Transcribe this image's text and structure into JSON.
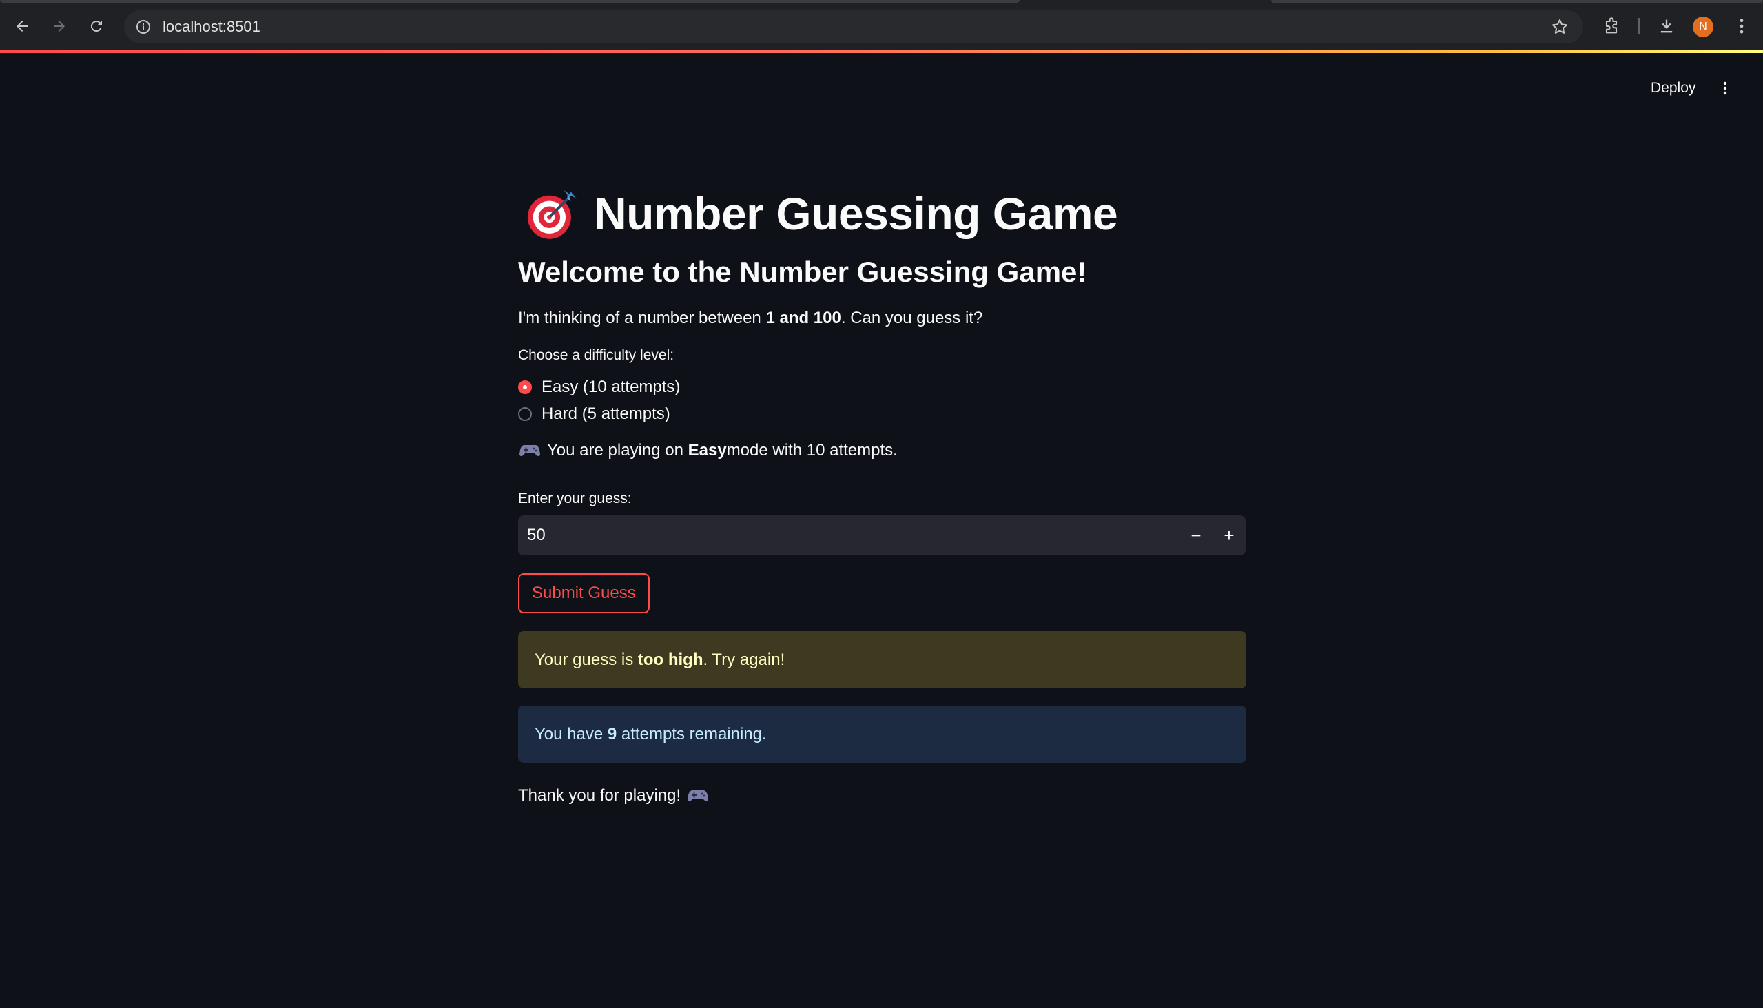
{
  "browser": {
    "url": "localhost:8501",
    "avatar_initial": "N"
  },
  "app_header": {
    "deploy_label": "Deploy"
  },
  "main": {
    "title": "Number Guessing Game",
    "subheading": "Welcome to the Number Guessing Game!",
    "intro": {
      "prefix": "I'm thinking of a number between ",
      "range": "1 and 100",
      "suffix": ". Can you guess it?"
    },
    "difficulty": {
      "label": "Choose a difficulty level:",
      "options": [
        {
          "label": "Easy (10 attempts)",
          "selected": true
        },
        {
          "label": "Hard (5 attempts)",
          "selected": false
        }
      ]
    },
    "mode_line": {
      "prefix": "You are playing on ",
      "mode": "Easy",
      "suffix": " mode with 10 attempts."
    },
    "guess": {
      "label": "Enter your guess:",
      "value": "50",
      "decrement_symbol": "−",
      "increment_symbol": "+"
    },
    "submit_label": "Submit Guess",
    "feedback": {
      "prefix": "Your guess is ",
      "strong": "too high",
      "suffix": ". Try again!"
    },
    "attempts": {
      "prefix": "You have ",
      "count": "9",
      "suffix": " attempts remaining."
    },
    "footer": "Thank you for playing!"
  },
  "colors": {
    "background": "#0e1117",
    "accent": "#ff4b4b",
    "warning_bg": "#3e3a22",
    "info_bg": "#1c2b41"
  },
  "icons": [
    "back-icon",
    "forward-icon",
    "reload-icon",
    "site-info-icon",
    "bookmark-star-icon",
    "extensions-icon",
    "download-icon",
    "chrome-menu-icon",
    "app-menu-icon",
    "direct-hit-icon",
    "gamepad-icon"
  ]
}
